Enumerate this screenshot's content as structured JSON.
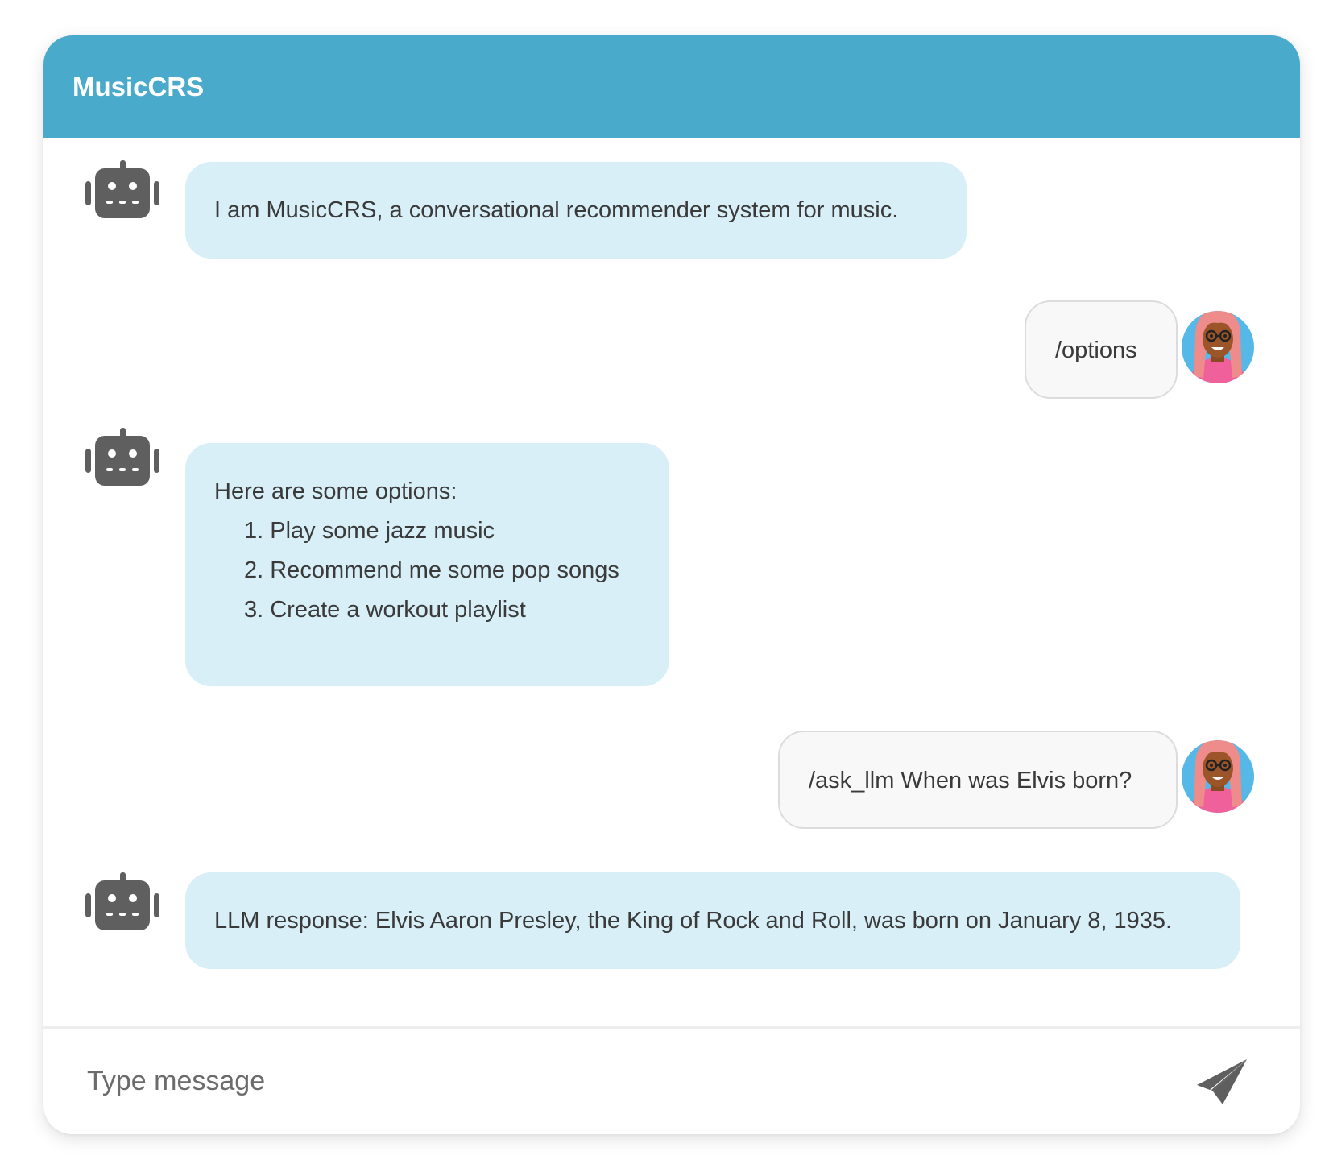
{
  "header": {
    "title": "MusicCRS"
  },
  "messages": [
    {
      "sender": "bot",
      "text": "I am MusicCRS, a conversational recommender system for music."
    },
    {
      "sender": "user",
      "text": "/options"
    },
    {
      "sender": "bot",
      "intro": "Here are some options:",
      "options": [
        "1. Play some jazz music",
        "2. Recommend me some pop songs",
        "3. Create a workout playlist"
      ]
    },
    {
      "sender": "user",
      "text": "/ask_llm When was Elvis born?"
    },
    {
      "sender": "bot",
      "text": "LLM response: Elvis Aaron Presley, the King of Rock and Roll, was born on January 8, 1935."
    }
  ],
  "composer": {
    "placeholder": "Type message",
    "value": ""
  },
  "icons": {
    "bot": "robot-icon",
    "user": "user-avatar",
    "send": "send-icon"
  },
  "colors": {
    "header": "#4aaacb",
    "bot_bubble": "#d8eff8",
    "user_bubble": "#f8f8f8",
    "icon_gray": "#5f5f5f"
  }
}
